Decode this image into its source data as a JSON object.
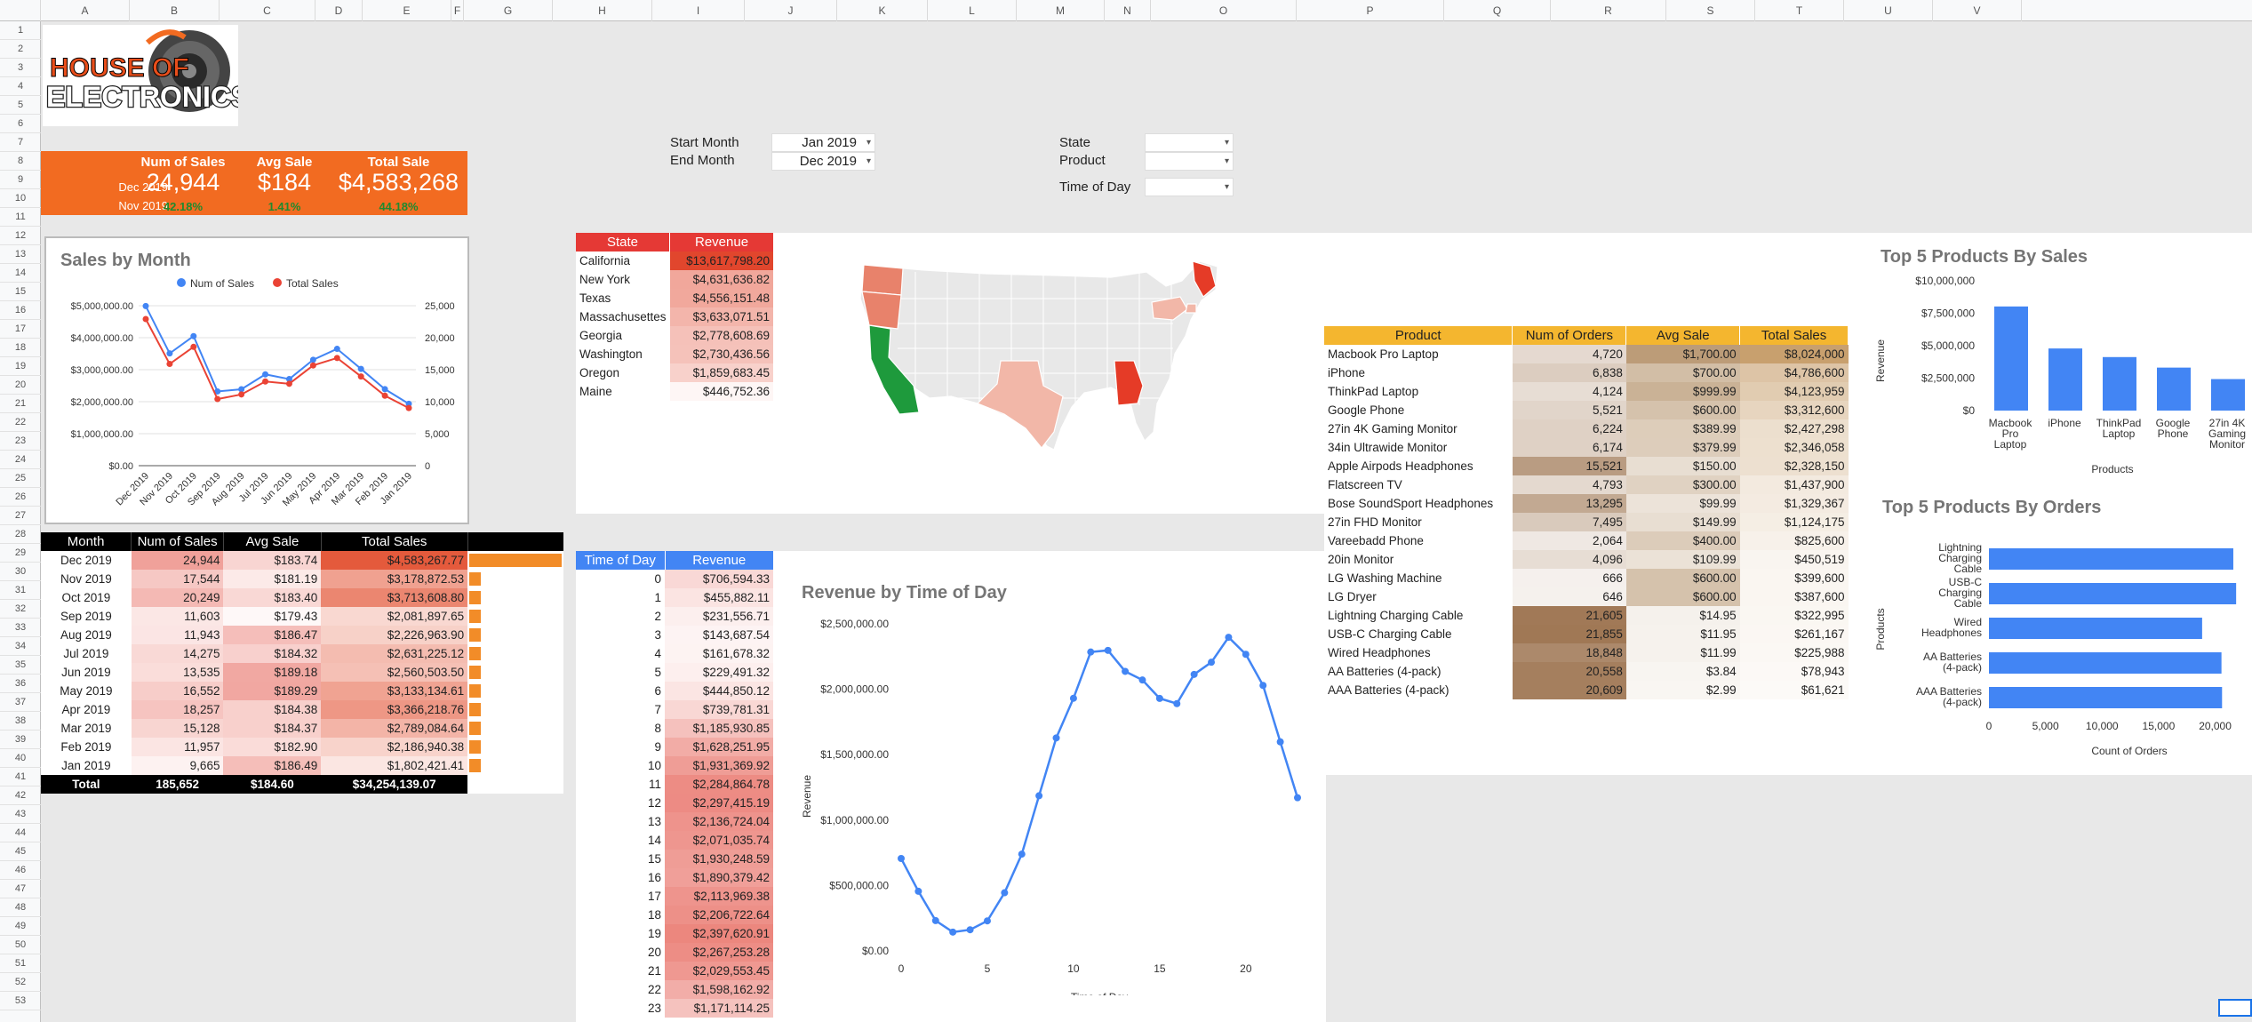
{
  "columns": [
    "A",
    "B",
    "C",
    "D",
    "E",
    "F",
    "G",
    "H",
    "I",
    "J",
    "K",
    "L",
    "M",
    "N",
    "O",
    "P",
    "Q",
    "R",
    "S",
    "T",
    "U",
    "V"
  ],
  "rows": [
    "1",
    "2",
    "3",
    "4",
    "5",
    "6",
    "7",
    "8",
    "9",
    "10",
    "11",
    "12",
    "13",
    "14",
    "15",
    "16",
    "17",
    "18",
    "19",
    "20",
    "21",
    "22",
    "23",
    "24",
    "25",
    "26",
    "27",
    "28",
    "29",
    "30",
    "31",
    "32",
    "33",
    "34",
    "35",
    "36",
    "37",
    "38",
    "39",
    "40",
    "41",
    "42",
    "43",
    "44",
    "45",
    "46",
    "47",
    "48",
    "49",
    "50",
    "51",
    "52",
    "53"
  ],
  "logo": {
    "line1": "HOUSE OF",
    "line2": "ELECTRONICS"
  },
  "kpi": {
    "headers": [
      "Num of Sales",
      "Avg Sale",
      "Total Sale"
    ],
    "current_month": "Dec 2019",
    "previous_month": "Nov 2019",
    "values": [
      "24,944",
      "$184",
      "$4,583,268"
    ],
    "changes": [
      "42.18%",
      "1.41%",
      "44.18%"
    ]
  },
  "filters": {
    "start_label": "Start Month",
    "start_value": "Jan 2019",
    "end_label": "End Month",
    "end_value": "Dec 2019",
    "state_label": "State",
    "product_label": "Product",
    "time_label": "Time of Day"
  },
  "sales_by_month_chart": {
    "title": "Sales by Month",
    "legend": [
      "Num of Sales",
      "Total Sales"
    ],
    "left_ticks": [
      "$5,000,000.00",
      "$4,000,000.00",
      "$3,000,000.00",
      "$2,000,000.00",
      "$1,000,000.00",
      "$0.00"
    ],
    "right_ticks": [
      "25,000",
      "20,000",
      "15,000",
      "10,000",
      "5,000",
      "0"
    ],
    "categories": [
      "Dec 2019",
      "Nov 2019",
      "Oct 2019",
      "Sep 2019",
      "Aug 2019",
      "Jul 2019",
      "Jun 2019",
      "May 2019",
      "Apr 2019",
      "Mar 2019",
      "Feb 2019",
      "Jan 2019"
    ],
    "colors": {
      "num": "#4285f4",
      "total": "#ea4335"
    }
  },
  "monthly_table": {
    "headers": [
      "Month",
      "Num of Sales",
      "Avg Sale",
      "Total Sales"
    ],
    "rows": [
      [
        "Dec 2019",
        "24,944",
        "$183.74",
        "$4,583,267.77"
      ],
      [
        "Nov 2019",
        "17,544",
        "$181.19",
        "$3,178,872.53"
      ],
      [
        "Oct 2019",
        "20,249",
        "$183.40",
        "$3,713,608.80"
      ],
      [
        "Sep 2019",
        "11,603",
        "$179.43",
        "$2,081,897.65"
      ],
      [
        "Aug 2019",
        "11,943",
        "$186.47",
        "$2,226,963.90"
      ],
      [
        "Jul 2019",
        "14,275",
        "$184.32",
        "$2,631,225.12"
      ],
      [
        "Jun 2019",
        "13,535",
        "$189.18",
        "$2,560,503.50"
      ],
      [
        "May 2019",
        "16,552",
        "$189.29",
        "$3,133,134.61"
      ],
      [
        "Apr 2019",
        "18,257",
        "$184.38",
        "$3,366,218.76"
      ],
      [
        "Mar 2019",
        "15,128",
        "$184.37",
        "$2,789,084.64"
      ],
      [
        "Feb 2019",
        "11,957",
        "$182.90",
        "$2,186,940.38"
      ],
      [
        "Jan 2019",
        "9,665",
        "$186.49",
        "$1,802,421.41"
      ]
    ],
    "total": [
      "Total",
      "185,652",
      "$184.60",
      "$34,254,139.07"
    ],
    "sparkbars": [
      1.0,
      0.12,
      0.12,
      0.12,
      0.12,
      0.12,
      0.12,
      0.12,
      0.12,
      0.12,
      0.12,
      0.12
    ]
  },
  "state_table": {
    "headers": [
      "State",
      "Revenue"
    ],
    "rows": [
      [
        "California",
        "$13,617,798.20"
      ],
      [
        "New York",
        "$4,631,636.82"
      ],
      [
        "Texas",
        "$4,556,151.48"
      ],
      [
        "Massachusettes",
        "$3,633,071.51"
      ],
      [
        "Georgia",
        "$2,778,608.69"
      ],
      [
        "Washington",
        "$2,730,436.56"
      ],
      [
        "Oregon",
        "$1,859,683.45"
      ],
      [
        "Maine",
        "$446,752.36"
      ]
    ]
  },
  "time_table": {
    "headers": [
      "Time of Day",
      "Revenue"
    ],
    "rows": [
      [
        "0",
        "$706,594.33"
      ],
      [
        "1",
        "$455,882.11"
      ],
      [
        "2",
        "$231,556.71"
      ],
      [
        "3",
        "$143,687.54"
      ],
      [
        "4",
        "$161,678.32"
      ],
      [
        "5",
        "$229,491.32"
      ],
      [
        "6",
        "$444,850.12"
      ],
      [
        "7",
        "$739,781.31"
      ],
      [
        "8",
        "$1,185,930.85"
      ],
      [
        "9",
        "$1,628,251.95"
      ],
      [
        "10",
        "$1,931,369.92"
      ],
      [
        "11",
        "$2,284,864.78"
      ],
      [
        "12",
        "$2,297,415.19"
      ],
      [
        "13",
        "$2,136,724.04"
      ],
      [
        "14",
        "$2,071,035.74"
      ],
      [
        "15",
        "$1,930,248.59"
      ],
      [
        "16",
        "$1,890,379.42"
      ],
      [
        "17",
        "$2,113,969.38"
      ],
      [
        "18",
        "$2,206,722.64"
      ],
      [
        "19",
        "$2,397,620.91"
      ],
      [
        "20",
        "$2,267,253.28"
      ],
      [
        "21",
        "$2,029,553.45"
      ],
      [
        "22",
        "$1,598,162.92"
      ],
      [
        "23",
        "$1,171,114.25"
      ]
    ]
  },
  "product_table": {
    "headers": [
      "Product",
      "Num of Orders",
      "Avg Sale",
      "Total Sales"
    ],
    "rows": [
      [
        "Macbook Pro Laptop",
        "4,720",
        "$1,700.00",
        "$8,024,000"
      ],
      [
        "iPhone",
        "6,838",
        "$700.00",
        "$4,786,600"
      ],
      [
        "ThinkPad Laptop",
        "4,124",
        "$999.99",
        "$4,123,959"
      ],
      [
        "Google Phone",
        "5,521",
        "$600.00",
        "$3,312,600"
      ],
      [
        "27in 4K Gaming Monitor",
        "6,224",
        "$389.99",
        "$2,427,298"
      ],
      [
        "34in Ultrawide Monitor",
        "6,174",
        "$379.99",
        "$2,346,058"
      ],
      [
        "Apple Airpods Headphones",
        "15,521",
        "$150.00",
        "$2,328,150"
      ],
      [
        "Flatscreen TV",
        "4,793",
        "$300.00",
        "$1,437,900"
      ],
      [
        "Bose SoundSport Headphones",
        "13,295",
        "$99.99",
        "$1,329,367"
      ],
      [
        "27in FHD Monitor",
        "7,495",
        "$149.99",
        "$1,124,175"
      ],
      [
        "Vareebadd Phone",
        "2,064",
        "$400.00",
        "$825,600"
      ],
      [
        "20in Monitor",
        "4,096",
        "$109.99",
        "$450,519"
      ],
      [
        "LG Washing Machine",
        "666",
        "$600.00",
        "$399,600"
      ],
      [
        "LG Dryer",
        "646",
        "$600.00",
        "$387,600"
      ],
      [
        "Lightning Charging Cable",
        "21,605",
        "$14.95",
        "$322,995"
      ],
      [
        "USB-C Charging Cable",
        "21,855",
        "$11.95",
        "$261,167"
      ],
      [
        "Wired Headphones",
        "18,848",
        "$11.99",
        "$225,988"
      ],
      [
        "AA Batteries (4-pack)",
        "20,558",
        "$3.84",
        "$78,943"
      ],
      [
        "AAA Batteries (4-pack)",
        "20,609",
        "$2.99",
        "$61,621"
      ]
    ]
  },
  "chart_data": [
    {
      "type": "line",
      "title": "Sales by Month",
      "categories": [
        "Dec 2019",
        "Nov 2019",
        "Oct 2019",
        "Sep 2019",
        "Aug 2019",
        "Jul 2019",
        "Jun 2019",
        "May 2019",
        "Apr 2019",
        "Mar 2019",
        "Feb 2019",
        "Jan 2019"
      ],
      "series": [
        {
          "name": "Num of Sales",
          "axis": "right",
          "values": [
            24944,
            17544,
            20249,
            11603,
            11943,
            14275,
            13535,
            16552,
            18257,
            15128,
            11957,
            9665
          ]
        },
        {
          "name": "Total Sales",
          "axis": "left",
          "values": [
            4583267.77,
            3178872.53,
            3713608.8,
            2081897.65,
            2226963.9,
            2631225.12,
            2560503.5,
            3133134.61,
            3366218.76,
            2789084.64,
            2186940.38,
            1802421.41
          ]
        }
      ],
      "ylim_left": [
        0,
        5000000
      ],
      "ylim_right": [
        0,
        25000
      ],
      "legend": "top"
    },
    {
      "type": "line",
      "title": "Revenue by Time of Day",
      "xlabel": "Time of Day",
      "ylabel": "Revenue",
      "x": [
        0,
        1,
        2,
        3,
        4,
        5,
        6,
        7,
        8,
        9,
        10,
        11,
        12,
        13,
        14,
        15,
        16,
        17,
        18,
        19,
        20,
        21,
        22,
        23
      ],
      "values": [
        706594.33,
        455882.11,
        231556.71,
        143687.54,
        161678.32,
        229491.32,
        444850.12,
        739781.31,
        1185930.85,
        1628251.95,
        1931369.92,
        2284864.78,
        2297415.19,
        2136724.04,
        2071035.74,
        1930248.59,
        1890379.42,
        2113969.38,
        2206722.64,
        2397620.91,
        2267253.28,
        2029553.45,
        1598162.92,
        1171114.25
      ],
      "ylim": [
        0,
        2500000
      ],
      "yticks": [
        "$2,500,000.00",
        "$2,000,000.00",
        "$1,500,000.00",
        "$1,000,000.00",
        "$500,000.00",
        "$0.00"
      ],
      "xticks": [
        "0",
        "5",
        "10",
        "15",
        "20"
      ],
      "color": "#4285f4"
    },
    {
      "type": "bar",
      "title": "Top 5 Products By Sales",
      "xlabel": "Products",
      "ylabel": "Revenue",
      "categories": [
        "Macbook Pro Laptop",
        "iPhone",
        "ThinkPad Laptop",
        "Google Phone",
        "27in 4K Gaming Monitor"
      ],
      "tick_labels": [
        [
          "Macbook",
          "Pro",
          "Laptop"
        ],
        [
          "iPhone"
        ],
        [
          "ThinkPad",
          "Laptop"
        ],
        [
          "Google",
          "Phone"
        ],
        [
          "27in 4K",
          "Gaming",
          "Monitor"
        ]
      ],
      "values": [
        8024000,
        4786600,
        4123959,
        3312600,
        2427298
      ],
      "ylim": [
        0,
        10000000
      ],
      "yticks": [
        "$10,000,000",
        "$7,500,000",
        "$5,000,000",
        "$2,500,000",
        "$0"
      ],
      "color": "#4285f4"
    },
    {
      "type": "bar",
      "orientation": "horizontal",
      "title": "Top 5 Products By Orders",
      "xlabel": "Count of Orders",
      "ylabel": "Products",
      "categories": [
        "Lightning Charging Cable",
        "USB-C Charging Cable",
        "Wired Headphones",
        "AA Batteries (4-pack)",
        "AAA Batteries (4-pack)"
      ],
      "tick_labels": [
        [
          "Lightning",
          "Charging",
          "Cable"
        ],
        [
          "USB-C",
          "Charging",
          "Cable"
        ],
        [
          "Wired",
          "Headphones"
        ],
        [
          "AA Batteries",
          "(4-pack)"
        ],
        [
          "AAA Batteries",
          "(4-pack)"
        ]
      ],
      "values": [
        21605,
        21855,
        18848,
        20558,
        20609
      ],
      "xlim": [
        0,
        22000
      ],
      "xticks": [
        "0",
        "5,000",
        "10,000",
        "15,000",
        "20,000"
      ],
      "color": "#4285f4"
    }
  ],
  "map": {
    "highlighted_states": [
      "California",
      "New York",
      "Texas",
      "Massachusetts",
      "Georgia",
      "Washington",
      "Oregon",
      "Maine"
    ],
    "colors": {
      "top": "#1e9a3c",
      "high": "#e53b27",
      "mid": "#e8826b",
      "low": "#f2b7a8",
      "base": "#e8e8e8"
    }
  }
}
